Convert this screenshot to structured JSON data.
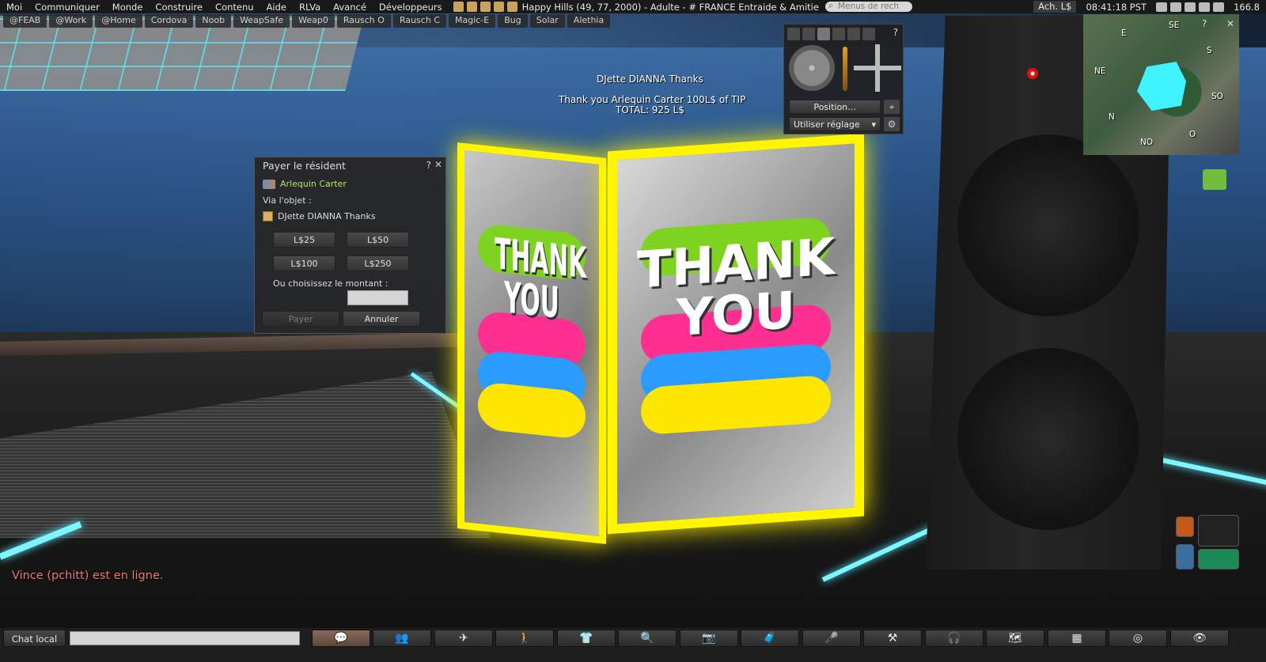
{
  "menu": {
    "items": [
      "Moi",
      "Communiquer",
      "Monde",
      "Construire",
      "Contenu",
      "Aide",
      "RLVa",
      "Avancé",
      "Développeurs"
    ],
    "location": "Happy Hills (49, 77, 2000) - Adulte - # FRANCE Entraide & Amitie",
    "search_placeholder": "Menus de rech",
    "buy_label": "Ach. L$",
    "time": "08:41:18 PST",
    "fps": "166.8"
  },
  "favorites": [
    "@FEAB",
    "@Work",
    "@Home",
    "Cordova",
    "Noob",
    "WeapSafe",
    "Weap0",
    "Rausch O",
    "Rausch C",
    "Magic-E",
    "Bug",
    "Solar",
    "Alethia"
  ],
  "hovertext": {
    "name": "DJette DIANNA Thanks",
    "line1": "Thank you Arlequin Carter 100L$ of TIP",
    "line2": "TOTAL: 925 L$"
  },
  "cube": {
    "word1": "THANK",
    "word2": "YOU"
  },
  "pay_dialog": {
    "title": "Payer le résident",
    "help": "?",
    "close": "✕",
    "resident": "Arlequin Carter",
    "via_label": "Via l'objet :",
    "object_name": "DJette DIANNA Thanks",
    "amounts": [
      "L$25",
      "L$50",
      "L$100",
      "L$250"
    ],
    "choose_label": "Ou choisissez le montant :",
    "amount_value": "",
    "pay_button": "Payer",
    "cancel_button": "Annuler"
  },
  "camera": {
    "help": "?",
    "position_button": "Position...",
    "preset_select": "Utiliser réglage"
  },
  "minimap": {
    "help": "?",
    "close": "✕",
    "labels": {
      "n": "N",
      "ne": "NE",
      "e": "E",
      "se": "SE",
      "s": "S",
      "so": "SO",
      "o": "O",
      "no": "NO"
    }
  },
  "chat_notice": "Vince (pchitt) est en ligne.",
  "bottombar": {
    "chat_label": "Chat local",
    "chat_value": "",
    "buttons": [
      "chat-icon",
      "people-icon",
      "fly-icon",
      "walk-icon",
      "shirt-icon",
      "search-icon",
      "camera-icon",
      "inventory-icon",
      "microphone-icon",
      "build-icon",
      "audio-icon",
      "map-icon",
      "minimap-icon",
      "radar-icon",
      "eye-icon"
    ]
  },
  "colors": {
    "cube_glow": "#fff500",
    "resident_name": "#b7e36a",
    "notice": "#f07777",
    "neon": "#7ff6ff"
  }
}
